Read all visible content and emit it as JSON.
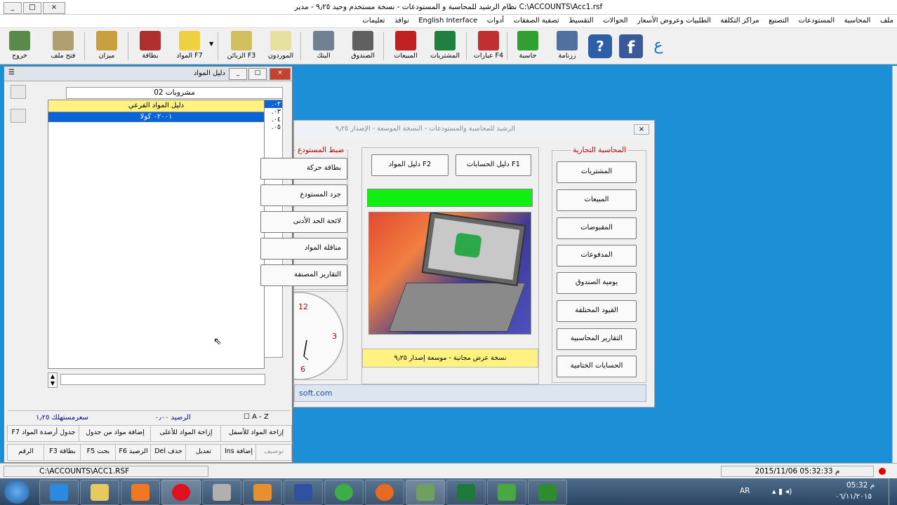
{
  "window": {
    "title": "نظام الرشيد للمحاسبة و المستودعات - نسخة مستخدم وحيد ٩٫٢٥ - مدير  C:\\ACCOUNTS\\Acc1.rsf",
    "controls": [
      "_",
      "□",
      "×"
    ]
  },
  "menu": [
    "ملف",
    "المحاسبة",
    "المستودعات",
    "التصنيع",
    "مراكز التكلفة",
    "الطلبيات وعروض الأسعار",
    "الحوالات",
    "التقسيط",
    "تصفية الصفقات",
    "أدوات",
    "English Interface",
    "نوافذ",
    "تعليمات"
  ],
  "toolbar": [
    {
      "label": "خروج",
      "icon": "exit-icon",
      "color": "#5a8a4a"
    },
    {
      "label": "فتح ملف",
      "icon": "open-file-icon",
      "color": "#b0a070"
    },
    {
      "label": "ميزان",
      "icon": "scale-icon",
      "color": "#c8a040"
    },
    {
      "label": "بطاقة",
      "icon": "card-icon",
      "color": "#b03030"
    },
    {
      "label": "المواد F7",
      "icon": "materials-icon",
      "color": "#f0d040"
    },
    {
      "label": "الزبائن F3",
      "icon": "customers-icon",
      "color": "#d0c060"
    },
    {
      "label": "الموردون",
      "icon": "suppliers-icon",
      "color": "#e8e0a0"
    },
    {
      "label": "البنك",
      "icon": "bank-icon",
      "color": "#708090"
    },
    {
      "label": "الصندوق",
      "icon": "cashbox-icon",
      "color": "#606060"
    },
    {
      "label": "المبيعات",
      "icon": "sales-icon",
      "color": "#c02020"
    },
    {
      "label": "المشتريات",
      "icon": "purchases-icon",
      "color": "#208040"
    },
    {
      "label": "عبارات F4",
      "icon": "journal-icon",
      "color": "#c03030"
    },
    {
      "label": "حاسبة",
      "icon": "calculator-icon",
      "color": "#30a030"
    },
    {
      "label": "رزنامة",
      "icon": "calendar-icon",
      "color": "#5070a0"
    }
  ],
  "toolbar_right": [
    {
      "icon": "help-icon",
      "label": "?"
    },
    {
      "icon": "facebook-icon",
      "label": "f"
    },
    {
      "icon": "arabic-icon",
      "label": "ع"
    }
  ],
  "materials_window": {
    "title": "دليل المواد",
    "category": "مشروبات 02",
    "sub_header": "دليل المواد الفرعي",
    "selected_row": "٠٢٠٠١ كولا",
    "right_list": [
      "٠٢.",
      "٠٣.",
      "٠٤.",
      "٠٥."
    ],
    "sort_label": "A - Z",
    "balance": "الرصيد ٠٫٠٠",
    "consumer_price": "سعرمستهلك ١٫٢٥",
    "row1": [
      "إزاحة المواد للأسفل",
      "إزاحة المواد للأعلى",
      "إضافة مواد من جدول",
      "F7 جدول أرصدة المواد"
    ],
    "row2": [
      "توصيف",
      "Ins إضافة",
      "تعديل",
      "Del حذف",
      "F6 الرصيد",
      "F5 بحث",
      "F3 بطاقة",
      "الرقم"
    ]
  },
  "info_window": {
    "title": "الرشيد للمحاسبة والمستودعات - النسخة الموسعة - الإصدار ٩٫٢٥",
    "accounting_group": "المحاسبة التجارية",
    "accounting_buttons": [
      "المشتريات",
      "المبيعات",
      "المقبوضات",
      "المدفوعات",
      "يومية الصندوق",
      "القيود المختلفة",
      "التقارير المحاسبية",
      "الحسابات الختامية"
    ],
    "guide_accounts": "دليل الحسابات F1",
    "guide_materials": "دليل المواد F2",
    "inventory_group": "ضبط المستودع",
    "inventory_buttons": [
      "بطاقة حركة",
      "جرد المستودع",
      "لائحة الحد الأدنى",
      "مناقلة المواد",
      "التقارير المصنفة"
    ],
    "clock_numbers": [
      "12",
      "3",
      "6"
    ],
    "demo_note": "نسخة عرض مجانية - موسعة إصدار ٩٫٢٥",
    "website": "soft.com"
  },
  "status": {
    "path": "C:\\ACCOUNTS\\ACC1.RSF",
    "datetime": "2015/11/06 05:32:33 م"
  },
  "taskbar": {
    "apps": [
      "start-icon",
      "ie-icon",
      "explorer-icon",
      "media-icon",
      "opera-icon",
      "tools-icon",
      "paint-icon",
      "infinity-icon",
      "chrome-icon",
      "firefox-icon",
      "calc-app-icon",
      "excel-icon",
      "camtasia-icon",
      "camtasia2-icon"
    ],
    "lang": "AR",
    "time": "05:32 م",
    "date": "٠٦/١١/٢٠١٥"
  }
}
